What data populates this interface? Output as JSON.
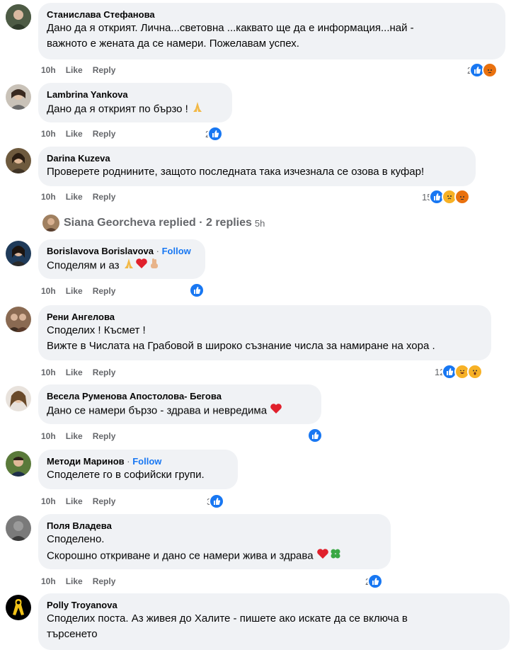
{
  "comments": [
    {
      "name": "Станислава Стефанова",
      "follow": "",
      "lines": [
        "Дано да я открият. Лична...световна ...каквато ще да е информация...най -",
        "важното е жената да се намери. Пожелавам успех."
      ],
      "time": "10h",
      "like": "Like",
      "reply": "Reply",
      "reactions_count": "2",
      "reactions": [
        "like-icon",
        "angry-icon"
      ]
    },
    {
      "name": "Lambrina Yankova",
      "follow": "",
      "lines": [
        "Дано да я открият по бързо !"
      ],
      "time": "10h",
      "like": "Like",
      "reply": "Reply",
      "reactions_count": "2",
      "reactions": [
        "like-icon"
      ]
    },
    {
      "name": "Darina Kuzeva",
      "follow": "",
      "lines": [
        "Проверете роднините, защото последната така изчезнала се озова в куфар!"
      ],
      "time": "10h",
      "like": "Like",
      "reply": "Reply",
      "reactions_count": "15",
      "reactions": [
        "like-icon",
        "sad-icon",
        "angry-icon"
      ]
    },
    {
      "name": "Borislavova Borislavova",
      "follow": "Follow",
      "lines": [
        "Споделям и аз"
      ],
      "time": "10h",
      "like": "Like",
      "reply": "Reply",
      "reactions_count": "",
      "reactions": [
        "like-icon"
      ]
    },
    {
      "name": "Рени Ангелова",
      "follow": "",
      "lines": [
        "Споделих ! Късмет !",
        "Вижте в Числата на Грабовой в широко съзнание числа за намиране на хора ."
      ],
      "time": "10h",
      "like": "Like",
      "reply": "Reply",
      "reactions_count": "12",
      "reactions": [
        "like-icon",
        "haha-icon",
        "wow-icon"
      ]
    },
    {
      "name": "Весела Руменова Апостолова- Бегова",
      "follow": "",
      "lines": [
        "Дано се намери бързо - здрава и невредима"
      ],
      "time": "10h",
      "like": "Like",
      "reply": "Reply",
      "reactions_count": "",
      "reactions": [
        "like-icon"
      ]
    },
    {
      "name": "Методи Маринов",
      "follow": "Follow",
      "lines": [
        "Споделете го в софийски групи."
      ],
      "time": "10h",
      "like": "Like",
      "reply": "Reply",
      "reactions_count": "3",
      "reactions": [
        "like-icon"
      ]
    },
    {
      "name": "Поля Владева",
      "follow": "",
      "lines": [
        "Споделено.",
        "Скорошно откриване и дано се намери жива и здрава"
      ],
      "time": "10h",
      "like": "Like",
      "reply": "Reply",
      "reactions_count": "2",
      "reactions": [
        "like-icon"
      ]
    },
    {
      "name": "Polly Troyanova",
      "follow": "",
      "lines": [
        "Споделих поста. Аз живея до Халите - пишете ако искате да се включа в",
        "търсенето"
      ],
      "time": "",
      "like": "",
      "reply": "",
      "reactions_count": "",
      "reactions": []
    }
  ],
  "replies_row": {
    "text": "Siana Georcheva replied · 2 replies",
    "ago": "5h"
  },
  "follow_sep": " · "
}
